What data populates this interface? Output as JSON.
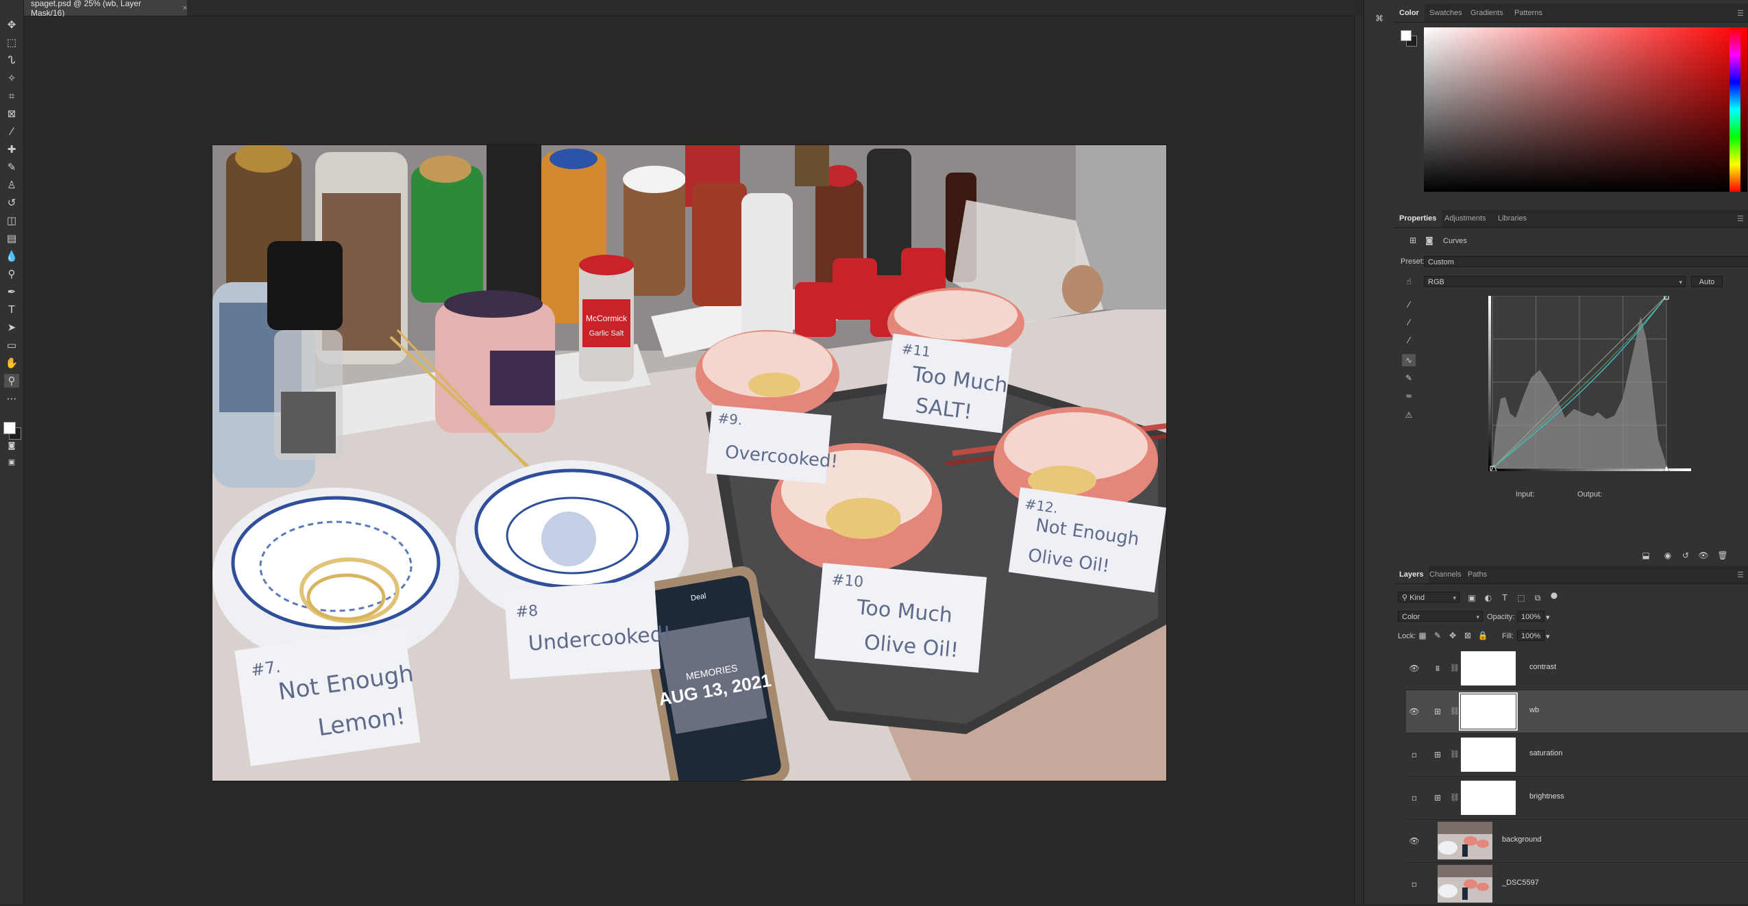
{
  "document": {
    "tab_title": "spaget.psd @ 25% (wb, Layer Mask/16)",
    "close_glyph": "×"
  },
  "photo": {
    "cards": [
      {
        "lines": [
          "#7.",
          "Not Enough",
          "Lemon!"
        ]
      },
      {
        "lines": [
          "#8",
          "Undercooked!"
        ]
      },
      {
        "lines": [
          "#9.",
          "Overcooked!"
        ]
      },
      {
        "lines": [
          "#10",
          "Too Much",
          "Olive Oil!"
        ]
      },
      {
        "lines": [
          "#11",
          "Too Much",
          "SALT!"
        ]
      },
      {
        "lines": [
          "#12.",
          "Not Enough",
          "Olive Oil!"
        ]
      }
    ],
    "phone": {
      "tag": "Deal",
      "memory_label": "MEMORIES",
      "date": "AUG 13, 2021"
    },
    "labels": {
      "mccormick": "McCormick",
      "garlic_salt": "Garlic Salt"
    }
  },
  "toolbar": {
    "tools": [
      {
        "name": "move-tool",
        "glyph": "✥"
      },
      {
        "name": "marquee-tool",
        "glyph": "⬚"
      },
      {
        "name": "lasso-tool",
        "glyph": "ᔐ"
      },
      {
        "name": "magic-wand-tool",
        "glyph": "✧"
      },
      {
        "name": "crop-tool",
        "glyph": "⌗"
      },
      {
        "name": "frame-tool",
        "glyph": "⊠"
      },
      {
        "name": "eyedropper-tool",
        "glyph": "⁄"
      },
      {
        "name": "healing-brush-tool",
        "glyph": "✚"
      },
      {
        "name": "brush-tool",
        "glyph": "✎"
      },
      {
        "name": "clone-stamp-tool",
        "glyph": "♙"
      },
      {
        "name": "history-brush-tool",
        "glyph": "↺"
      },
      {
        "name": "eraser-tool",
        "glyph": "◫"
      },
      {
        "name": "gradient-tool",
        "glyph": "▤"
      },
      {
        "name": "blur-tool",
        "glyph": "💧"
      },
      {
        "name": "dodge-tool",
        "glyph": "⚲"
      },
      {
        "name": "pen-tool",
        "glyph": "✒"
      },
      {
        "name": "type-tool",
        "glyph": "T"
      },
      {
        "name": "path-selection-tool",
        "glyph": "➤"
      },
      {
        "name": "rectangle-tool",
        "glyph": "▭"
      },
      {
        "name": "hand-tool",
        "glyph": "✋"
      },
      {
        "name": "zoom-tool",
        "glyph": "⚲"
      },
      {
        "name": "more-tools",
        "glyph": "⋯"
      }
    ]
  },
  "color_panel": {
    "tabs": [
      "Color",
      "Swatches",
      "Gradients",
      "Patterns"
    ],
    "foreground": "#ffffff",
    "background": "#1e1e1e",
    "hue": "#ff0000"
  },
  "properties_panel": {
    "tabs": [
      "Properties",
      "Adjustments",
      "Libraries"
    ],
    "adjustment_name": "Curves",
    "preset_label": "Preset:",
    "preset_value": "Custom",
    "channel_value": "RGB",
    "auto_label": "Auto",
    "input_label": "Input:",
    "output_label": "Output:"
  },
  "layers_panel": {
    "tabs": [
      "Layers",
      "Channels",
      "Paths"
    ],
    "kind_filter": "Kind",
    "blend_mode": "Color",
    "opacity_label": "Opacity:",
    "opacity_value": "100%",
    "lock_label": "Lock:",
    "fill_label": "Fill:",
    "fill_value": "100%",
    "layers": [
      {
        "name": "contrast",
        "visible": true,
        "type": "levels"
      },
      {
        "name": "wb",
        "visible": true,
        "type": "curves",
        "selected": true
      },
      {
        "name": "saturation",
        "visible": false,
        "type": "curves"
      },
      {
        "name": "brightness",
        "visible": false,
        "type": "curves"
      },
      {
        "name": "background",
        "visible": true,
        "type": "pixel"
      },
      {
        "name": "_DSC5597",
        "visible": false,
        "type": "pixel"
      }
    ]
  }
}
